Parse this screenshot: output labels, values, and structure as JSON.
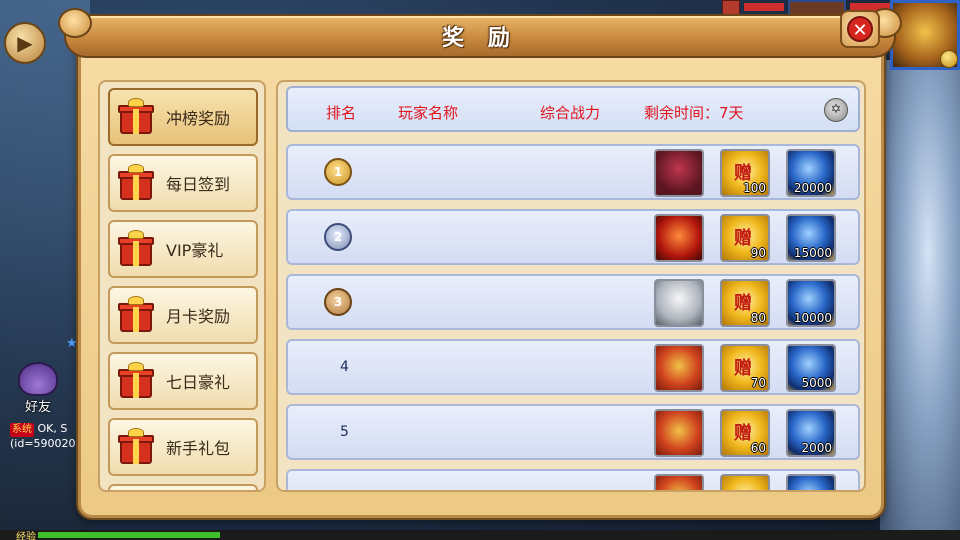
{
  "window": {
    "title": "奖 励"
  },
  "menu": {
    "items": [
      {
        "label": "冲榜奖励",
        "active": true
      },
      {
        "label": "每日签到",
        "active": false
      },
      {
        "label": "VIP豪礼",
        "active": false
      },
      {
        "label": "月卡奖励",
        "active": false
      },
      {
        "label": "七日豪礼",
        "active": false
      },
      {
        "label": "新手礼包",
        "active": false
      }
    ]
  },
  "table": {
    "headers": {
      "rank": "排名",
      "player": "玩家名称",
      "power": "综合战力",
      "time_left": "剩余时间：7天"
    },
    "rows": [
      {
        "rank": "1",
        "medal": "gold",
        "rewards": [
          {
            "type": "hero",
            "qty": ""
          },
          {
            "type": "coin",
            "qty": "100"
          },
          {
            "type": "orb",
            "qty": "20000"
          }
        ]
      },
      {
        "rank": "2",
        "medal": "silver",
        "rewards": [
          {
            "type": "hero",
            "qty": ""
          },
          {
            "type": "coin",
            "qty": "90"
          },
          {
            "type": "orb",
            "qty": "15000"
          }
        ]
      },
      {
        "rank": "3",
        "medal": "bronze",
        "rewards": [
          {
            "type": "hero",
            "qty": ""
          },
          {
            "type": "coin",
            "qty": "80"
          },
          {
            "type": "orb",
            "qty": "10000"
          }
        ]
      },
      {
        "rank": "4",
        "medal": "",
        "rewards": [
          {
            "type": "scroll",
            "qty": ""
          },
          {
            "type": "coin",
            "qty": "70"
          },
          {
            "type": "orb",
            "qty": "5000"
          }
        ]
      },
      {
        "rank": "5",
        "medal": "",
        "rewards": [
          {
            "type": "scroll",
            "qty": ""
          },
          {
            "type": "coin",
            "qty": "60"
          },
          {
            "type": "orb",
            "qty": "2000"
          }
        ]
      }
    ]
  },
  "hud": {
    "friend_label": "好友",
    "chat_tag": "系统",
    "chat_text": "OK, S",
    "chat_id": "(id=590020",
    "exp_label": "经验",
    "coin_glyph": "赠",
    "close_glyph": "✕",
    "back_glyph": "▶",
    "star_glyph": "★",
    "header_icon_glyph": "✡"
  },
  "colors": {
    "header_text": "#e0141a",
    "panel": "#f6dba4",
    "title_bar": "#c98a3f"
  }
}
